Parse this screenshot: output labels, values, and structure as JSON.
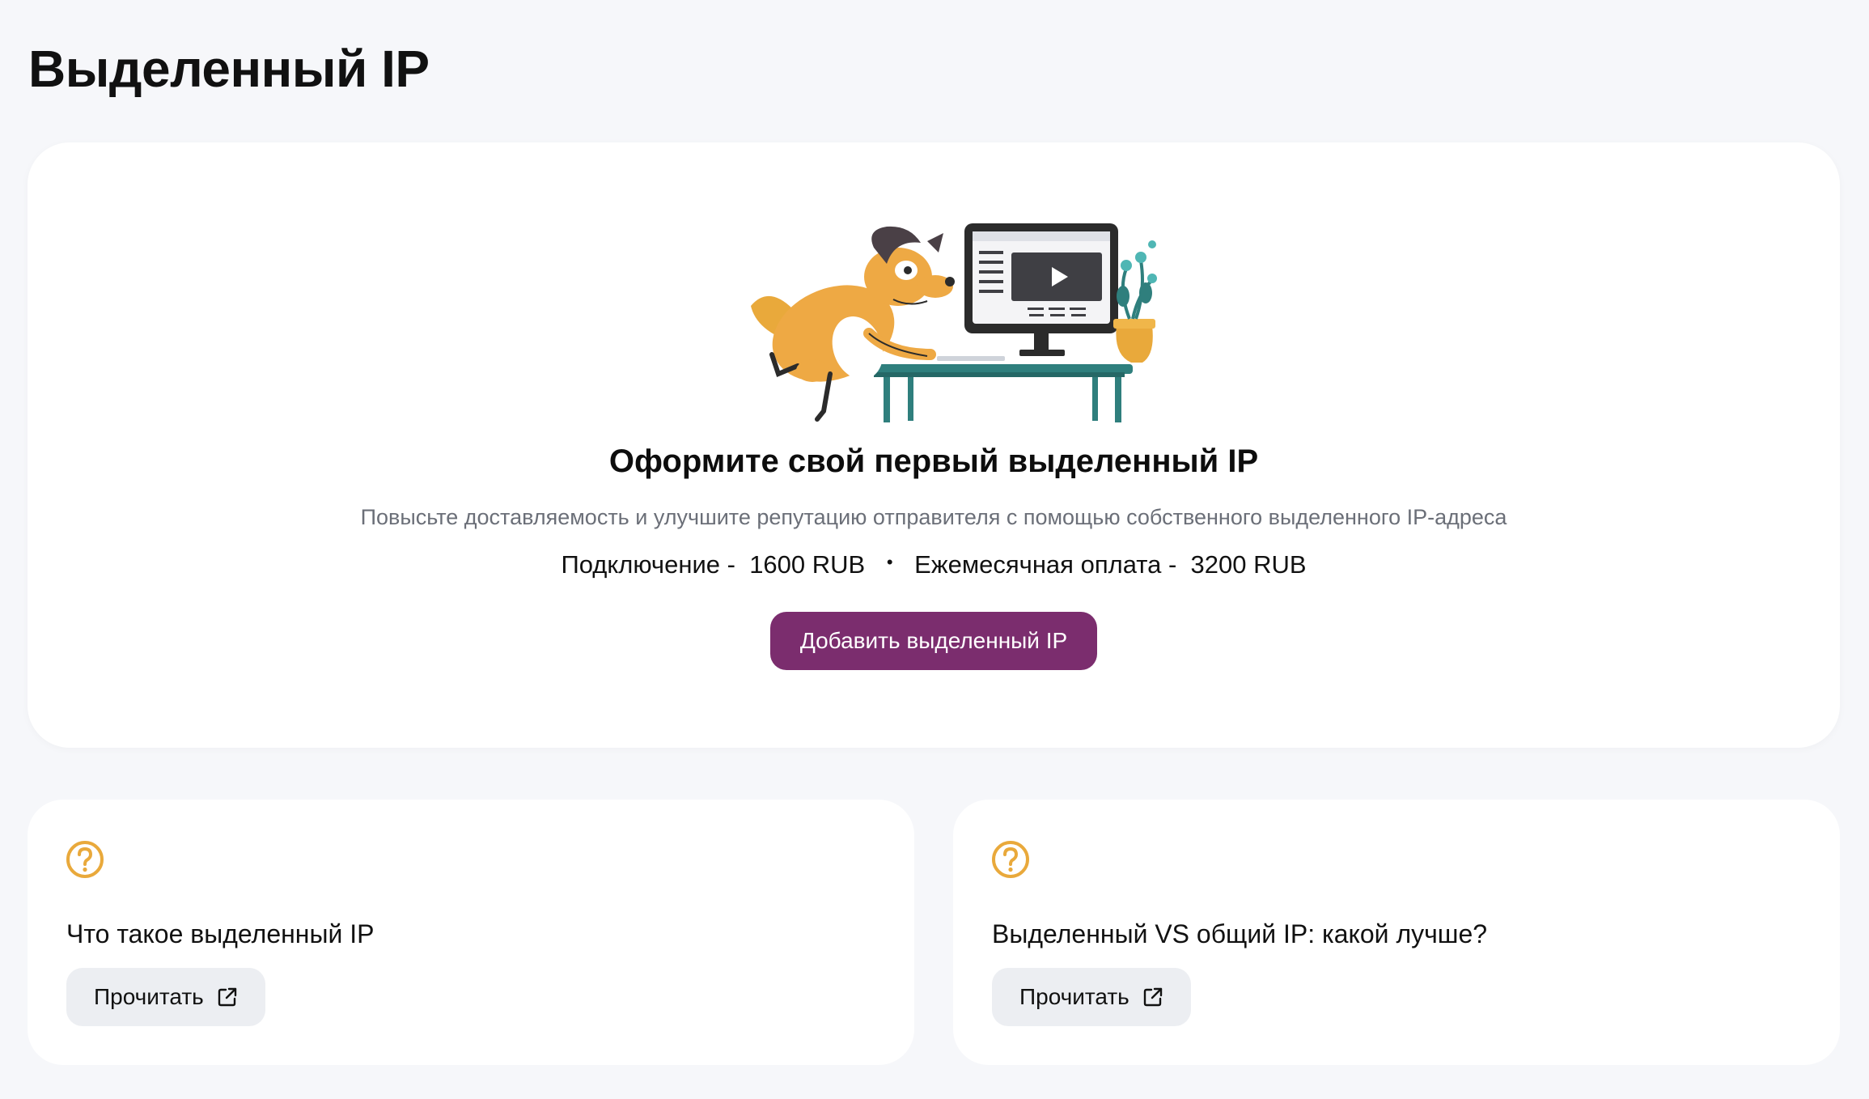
{
  "page": {
    "title": "Выделенный IP"
  },
  "hero": {
    "title": "Оформите свой первый выделенный IP",
    "subtitle": "Повысьте доставляемость и улучшите репутацию отправителя с помощью собственного выделенного IP-адреса",
    "connection_label": "Подключение -",
    "connection_price": "1600 RUB",
    "separator": "•",
    "monthly_label": "Ежемесячная оплата -",
    "monthly_price": "3200 RUB",
    "button_label": "Добавить выделенный IP",
    "illustration": "dog-at-computer-illustration"
  },
  "cards": [
    {
      "icon": "question-circle-icon",
      "title": "Что такое выделенный IP",
      "button_label": "Прочитать",
      "button_icon": "external-link-icon"
    },
    {
      "icon": "question-circle-icon",
      "title": "Выделенный VS общий IP: какой лучше?",
      "button_label": "Прочитать",
      "button_icon": "external-link-icon"
    }
  ],
  "colors": {
    "background": "#f6f7fa",
    "primary_button": "#7b2d6e",
    "icon_accent": "#e9a93b",
    "secondary_button": "#eceef2"
  }
}
